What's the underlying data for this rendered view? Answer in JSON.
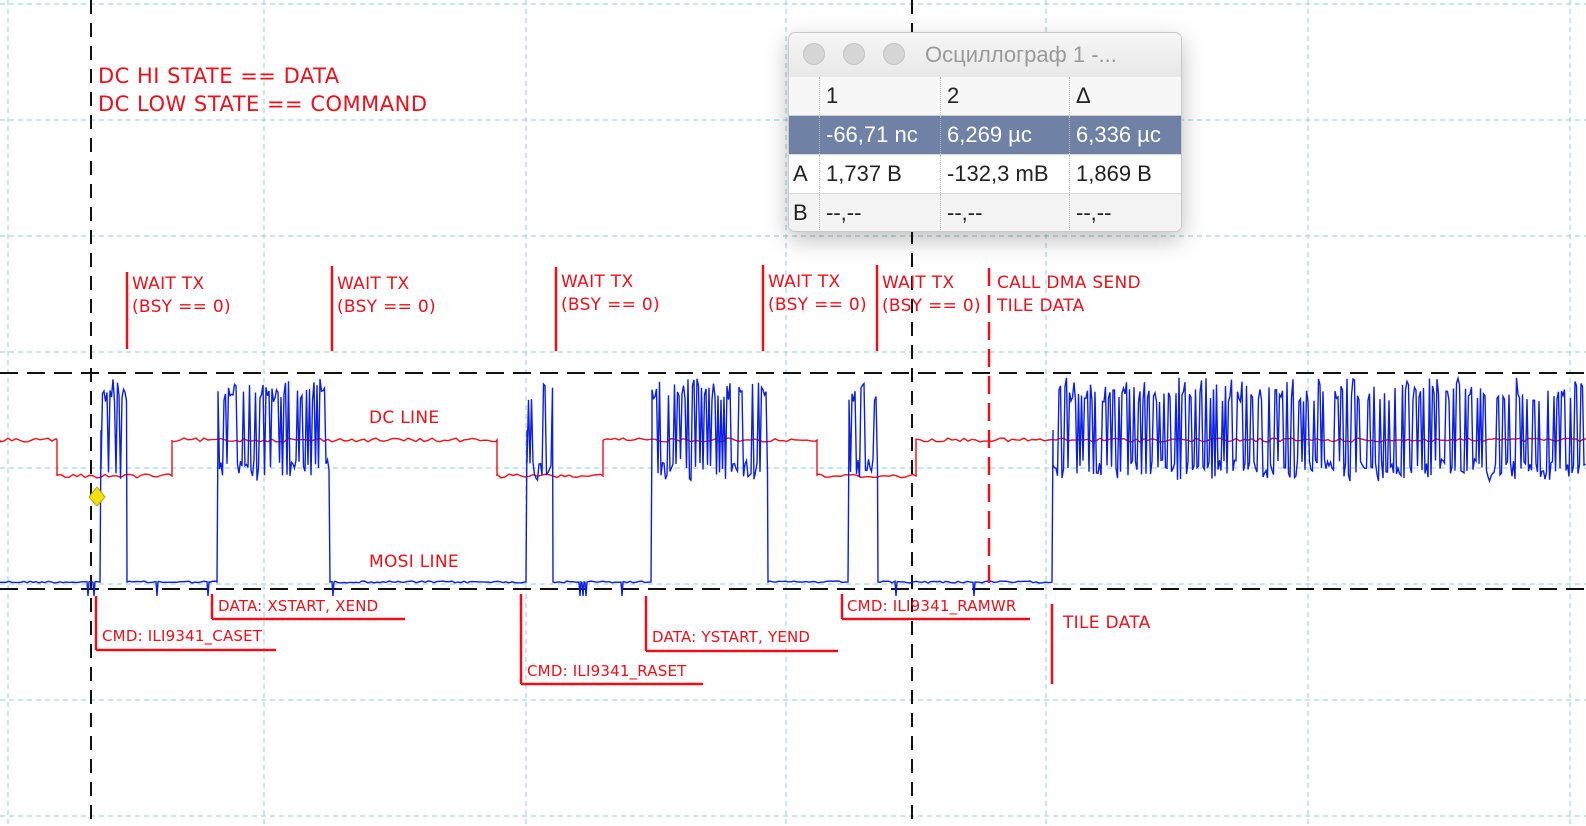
{
  "colors": {
    "dc_line": "#e8111b",
    "mosi_line": "#0b1fe0",
    "annotation": "#e8111b",
    "grid": "#a8d4e0",
    "cursor": "#111111",
    "marker": "#f2e10f",
    "selected_row": "#6f82a6"
  },
  "legend": {
    "line1": "DC HI STATE == DATA",
    "line2": "DC LOW STATE == COMMAND"
  },
  "traces": {
    "dc_label": "DC LINE",
    "mosi_label": "MOSI LINE"
  },
  "annotations": {
    "wait_tx": [
      {
        "title": "WAIT TX",
        "sub": "(BSY == 0)"
      },
      {
        "title": "WAIT TX",
        "sub": "(BSY == 0)"
      },
      {
        "title": "WAIT TX",
        "sub": "(BSY == 0)"
      },
      {
        "title": "WAIT TX",
        "sub": "(BSY == 0)"
      },
      {
        "title": "WAIT TX",
        "sub": "(BSY == 0)"
      }
    ],
    "dma": {
      "title": "CALL DMA SEND",
      "sub": "TILE DATA"
    },
    "phases": [
      "CMD: ILI9341_CASET",
      "DATA: XSTART, XEND",
      "CMD: ILI9341_RASET",
      "DATA: YSTART, YEND",
      "CMD: ILI9341_RAMWR",
      "TILE DATA"
    ]
  },
  "measurement_window": {
    "title": "Осциллограф 1 -...",
    "columns": [
      "",
      "1",
      "2",
      "Δ"
    ],
    "rows": [
      {
        "label": "",
        "c1": "-66,71 nc",
        "c2": "6,269 µc",
        "c3": "6,336 µc",
        "selected": true
      },
      {
        "label": "A",
        "c1": "1,737 B",
        "c2": "-132,3 mB",
        "c3": "1,869 B"
      },
      {
        "label": "B",
        "c1": "--,--",
        "c2": "--,--",
        "c3": "--,--"
      }
    ]
  }
}
